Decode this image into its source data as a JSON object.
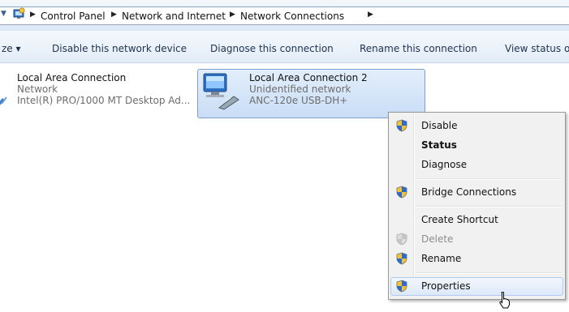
{
  "address_bar": {
    "breadcrumbs": [
      "Control Panel",
      "Network and Internet",
      "Network Connections"
    ]
  },
  "toolbar": {
    "organize_partial": "ze",
    "disable_device": "Disable this network device",
    "diagnose": "Diagnose this connection",
    "rename": "Rename this connection",
    "view_status": "View status of"
  },
  "connections": [
    {
      "name": "Local Area Connection",
      "status": "Network",
      "device": "Intel(R) PRO/1000 MT Desktop Ad..."
    },
    {
      "name": "Local Area Connection 2",
      "status": "Unidentified network",
      "device": "ANC-120e USB-DH+"
    }
  ],
  "context_menu": {
    "items": [
      {
        "label": "Disable",
        "shield": true
      },
      {
        "label": "Status",
        "default": true
      },
      {
        "label": "Diagnose"
      },
      {
        "label": "Bridge Connections",
        "shield": true
      },
      {
        "label": "Create Shortcut"
      },
      {
        "label": "Delete",
        "shield": true,
        "disabled": true
      },
      {
        "label": "Rename",
        "shield": true
      },
      {
        "label": "Properties",
        "shield": true,
        "hovered": true
      }
    ]
  },
  "icons": {
    "shield": "uac-shield-icon",
    "network_adapter": "network-adapter-icon",
    "control_panel": "control-panel-icon"
  },
  "colors": {
    "selection": "#c9ddf6",
    "toolbar_text": "#1e3250",
    "menu_bg": "#f1f1f1"
  }
}
